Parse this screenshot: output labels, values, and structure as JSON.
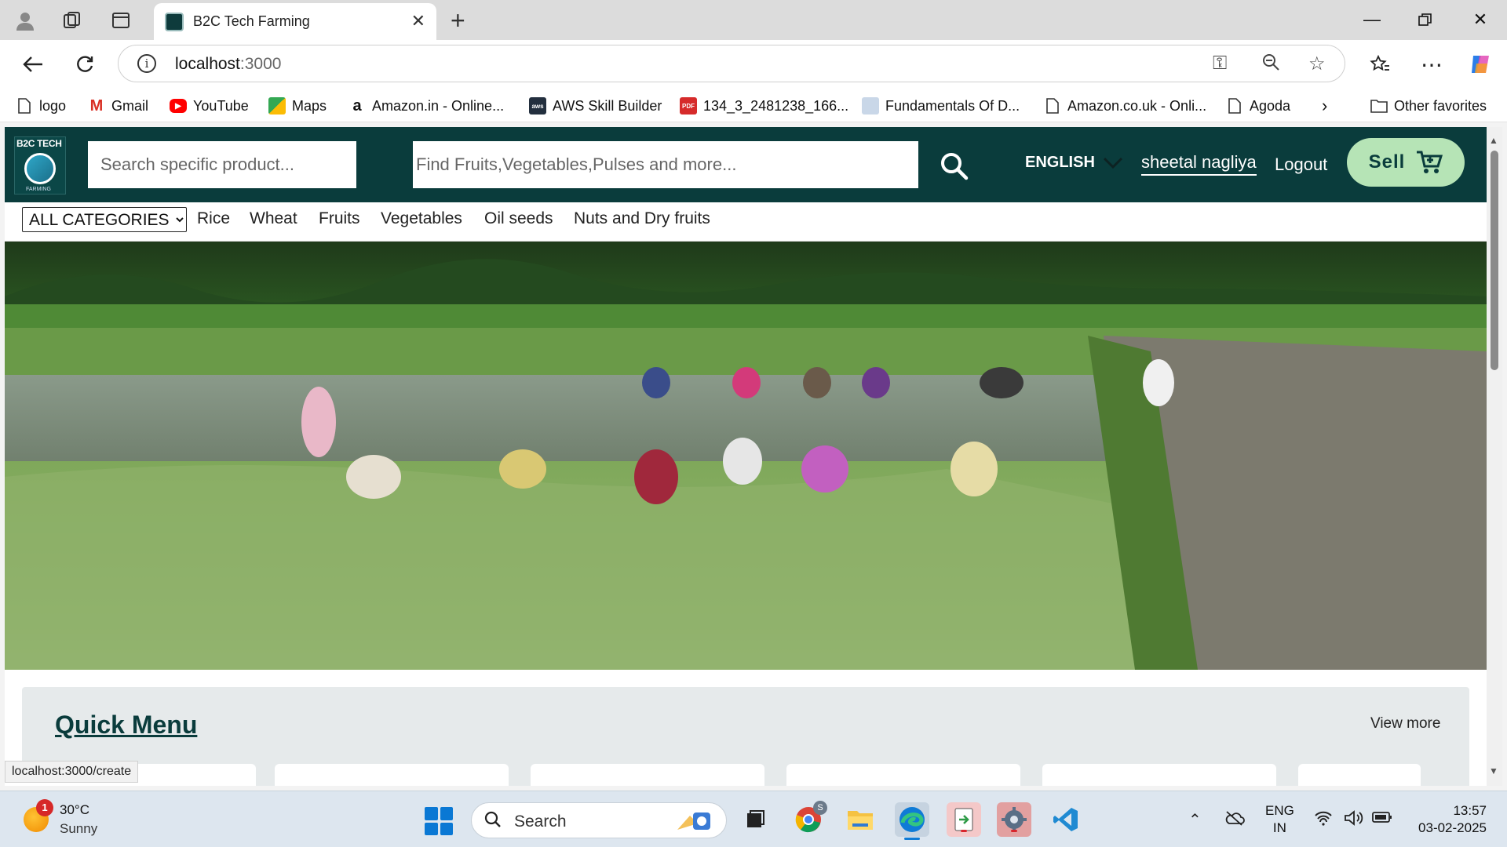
{
  "browser": {
    "tab_title": "B2C Tech Farming",
    "url_host": "localhost",
    "url_port": ":3000",
    "favorites": [
      {
        "label": "logo",
        "icon": "page-icon"
      },
      {
        "label": "Gmail",
        "icon": "gmail-icon"
      },
      {
        "label": "YouTube",
        "icon": "youtube-icon"
      },
      {
        "label": "Maps",
        "icon": "maps-icon"
      },
      {
        "label": "Amazon.in - Online...",
        "icon": "amazon-icon"
      },
      {
        "label": "AWS Skill Builder",
        "icon": "aws-icon"
      },
      {
        "label": "134_3_2481238_166...",
        "icon": "pdf-icon"
      },
      {
        "label": "Fundamentals Of D...",
        "icon": "site-icon"
      },
      {
        "label": "Amazon.co.uk - Onli...",
        "icon": "page-icon"
      },
      {
        "label": "Agoda",
        "icon": "page-icon"
      }
    ],
    "other_favorites": "Other favorites",
    "status_url": "localhost:3000/create"
  },
  "site": {
    "logo_text": "B2C TECH",
    "logo_sub": "FARMING",
    "search_small_placeholder": "Search specific product...",
    "search_big_placeholder": "Find Fruits,Vegetables,Pulses and more...",
    "language": "ENGLISH",
    "user_name": "sheetal nagliya",
    "logout": "Logout",
    "sell": "Sell",
    "category_select": "ALL CATEGORIES",
    "categories": [
      "Rice",
      "Wheat",
      "Fruits",
      "Vegetables",
      "Oil seeds",
      "Nuts and Dry fruits"
    ],
    "quick_menu_title": "Quick Menu",
    "view_more": "View more"
  },
  "taskbar": {
    "weather_badge": "1",
    "temp": "30°C",
    "weather": "Sunny",
    "search_label": "Search",
    "chrome_badge": "S",
    "lang_line1": "ENG",
    "lang_line2": "IN",
    "time": "13:57",
    "date": "03-02-2025"
  },
  "colors": {
    "brand_dark": "#0a3c3c",
    "sell_green": "#b6e4b6",
    "quick_menu_bg": "#e6eaeb"
  }
}
